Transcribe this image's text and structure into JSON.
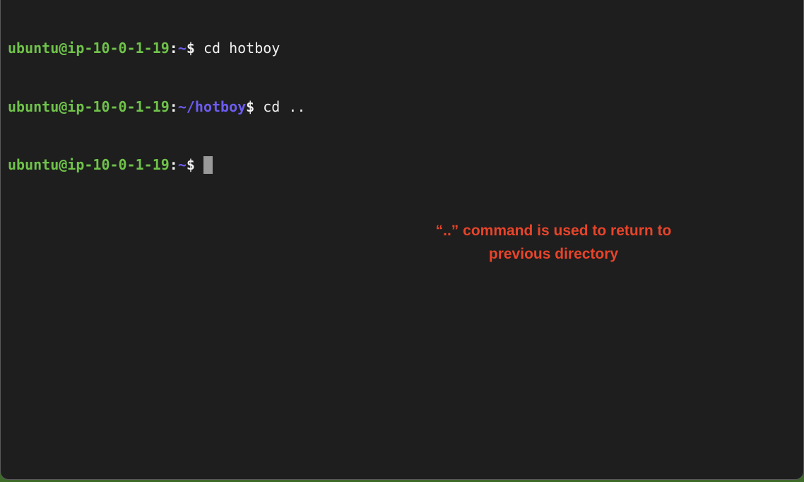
{
  "terminal": {
    "lines": [
      {
        "user_host": "ubuntu@ip-10-0-1-19",
        "colon": ":",
        "path": "~",
        "prompt": "$",
        "command": " cd hotboy"
      },
      {
        "user_host": "ubuntu@ip-10-0-1-19",
        "colon": ":",
        "path": "~/hotboy",
        "prompt": "$",
        "command": " cd .."
      },
      {
        "user_host": "ubuntu@ip-10-0-1-19",
        "colon": ":",
        "path": "~",
        "prompt": "$",
        "command": ""
      }
    ]
  },
  "annotation": {
    "line1": "“..” command is used to return to",
    "line2": "previous directory"
  },
  "colors": {
    "background": "#1e1e1e",
    "user_host": "#6fc24a",
    "path": "#6c5cf0",
    "text": "#f0f0f0",
    "annotation": "#e8442a",
    "cursor": "#9a9a9a"
  }
}
